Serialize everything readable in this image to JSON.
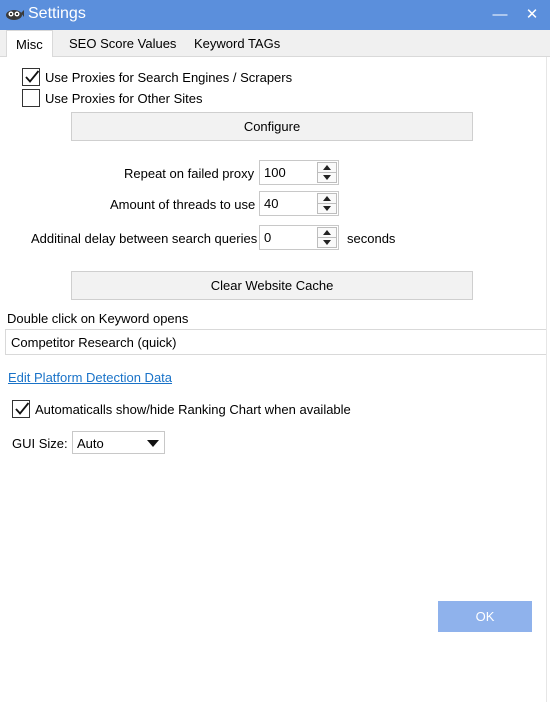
{
  "window": {
    "title": "Settings",
    "min_glyph": "—",
    "close_glyph": "✕"
  },
  "tabs": [
    {
      "label": "Misc",
      "active": true
    },
    {
      "label": "SEO Score Values",
      "active": false
    },
    {
      "label": "Keyword TAGs",
      "active": false
    }
  ],
  "proxies": {
    "search_engines_label": "Use Proxies for Search Engines / Scrapers",
    "search_engines_checked": true,
    "other_sites_label": "Use Proxies for Other Sites",
    "other_sites_checked": false,
    "configure_label": "Configure"
  },
  "spinners": {
    "repeat_label": "Repeat on failed  proxy",
    "repeat_value": "100",
    "threads_label": "Amount of threads to use",
    "threads_value": "40",
    "delay_label": "Additinal delay between search queries",
    "delay_value": "0",
    "delay_unit": "seconds"
  },
  "cache": {
    "clear_label": "Clear Website Cache"
  },
  "keyword_open": {
    "label": "Double click on Keyword opens",
    "value": "Competitor Research (quick)"
  },
  "platform": {
    "link_label": "Edit Platform Detection Data"
  },
  "ranking_chart": {
    "label": "Automaticalls show/hide Ranking Chart when available",
    "checked": true
  },
  "gui_size": {
    "label": "GUI Size:",
    "value": "Auto"
  },
  "footer": {
    "ok_label": "OK"
  }
}
